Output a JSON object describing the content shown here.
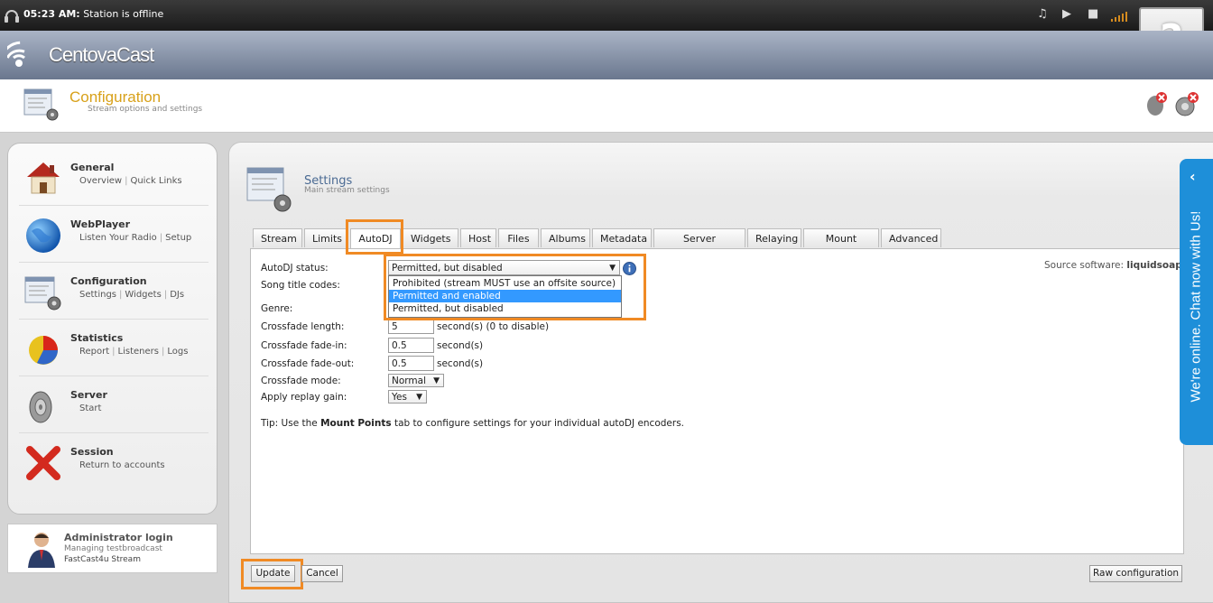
{
  "topbar": {
    "time": "05:23 AM:",
    "status": "Station is offline"
  },
  "helpbox": {
    "label": "?"
  },
  "brand": {
    "name": "CentovaCast"
  },
  "page": {
    "title": "Configuration",
    "subtitle": "Stream options and settings"
  },
  "sidebar": {
    "items": [
      {
        "name": "General",
        "links": [
          "Overview",
          "Quick Links"
        ],
        "icon": "house-icon"
      },
      {
        "name": "WebPlayer",
        "links": [
          "Listen Your Radio",
          "Setup"
        ],
        "icon": "globe-icon"
      },
      {
        "name": "Configuration",
        "links": [
          "Settings",
          "Widgets",
          "DJs"
        ],
        "icon": "config-icon"
      },
      {
        "name": "Statistics",
        "links": [
          "Report",
          "Listeners",
          "Logs"
        ],
        "icon": "pie-chart-icon"
      },
      {
        "name": "Server",
        "links": [
          "Start"
        ],
        "icon": "speaker-icon"
      },
      {
        "name": "Session",
        "links": [
          "Return to accounts"
        ],
        "icon": "x-icon"
      }
    ]
  },
  "admin": {
    "name": "Administrator login",
    "line2": "Managing testbroadcast",
    "line3": "FastCast4u Stream"
  },
  "settings": {
    "title": "Settings",
    "subtitle": "Main stream settings"
  },
  "tabs": [
    "Stream",
    "Limits",
    "AutoDJ",
    "Widgets",
    "Host",
    "Files",
    "Albums",
    "Metadata",
    "Server Overrides",
    "Relaying",
    "Mount Points",
    "Advanced"
  ],
  "active_tab": "AutoDJ",
  "source": {
    "label": "Source software:",
    "value": "liquidsoap"
  },
  "form": {
    "autodj_status_label": "AutoDJ status:",
    "autodj_status_value": "Permitted, but disabled",
    "song_codes_label": "Song title codes:",
    "genre_label": "Genre:",
    "crossfade_length_label": "Crossfade length:",
    "crossfade_length_value": "5",
    "crossfade_length_unit": "second(s) (0 to disable)",
    "crossfade_in_label": "Crossfade fade-in:",
    "crossfade_in_value": "0.5",
    "crossfade_in_unit": "second(s)",
    "crossfade_out_label": "Crossfade fade-out:",
    "crossfade_out_value": "0.5",
    "crossfade_out_unit": "second(s)",
    "crossfade_mode_label": "Crossfade mode:",
    "crossfade_mode_value": "Normal",
    "replay_gain_label": "Apply replay gain:",
    "replay_gain_value": "Yes"
  },
  "dropdown_options": [
    "Prohibited (stream MUST use an offsite source)",
    "Permitted and enabled",
    "Permitted, but disabled"
  ],
  "highlighted_option": "Permitted and enabled",
  "tip": {
    "prefix": "Tip: Use the",
    "bold": "Mount Points",
    "suffix": "tab to configure settings for your individual autoDJ encoders."
  },
  "buttons": {
    "update": "Update",
    "cancel": "Cancel",
    "raw": "Raw configuration"
  },
  "chat": {
    "text": "We're online. Chat now with Us!"
  },
  "colors": {
    "accent_orange": "#f08a24",
    "title_gold": "#d8a11a",
    "chat_blue": "#1e8fd9",
    "highlight_blue": "#3399ff"
  }
}
